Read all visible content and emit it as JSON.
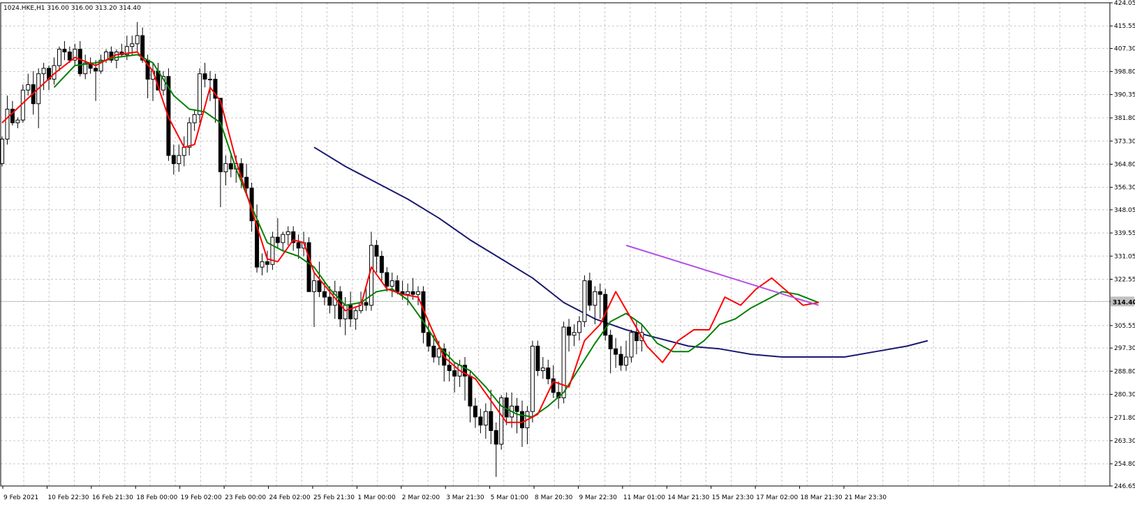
{
  "header": {
    "symbol": "1024.HKE,H1",
    "open": "316.00",
    "high": "316.00",
    "low": "313.20",
    "close": "314.40"
  },
  "colors": {
    "background": "#ffffff",
    "grid": "#c8c8c8",
    "axis": "#000000",
    "candle_up_body": "#ffffff",
    "candle_down_body": "#000000",
    "candle_outline": "#000000",
    "ma_red": "#ff0000",
    "ma_green": "#008000",
    "ma_navy": "#191970",
    "trend_purple": "#b450e6",
    "price_line": "#c0c0c0",
    "price_label_bg": "#c0c0c0"
  },
  "chart_data": {
    "type": "candlestick",
    "grid": true,
    "ylim": [
      246.65,
      424.05
    ],
    "y_ticks": [
      "424.05",
      "415.55",
      "407.30",
      "398.80",
      "390.35",
      "381.80",
      "373.30",
      "364.80",
      "356.30",
      "348.05",
      "339.55",
      "331.05",
      "322.55",
      "314.40",
      "305.55",
      "297.30",
      "288.80",
      "280.30",
      "271.80",
      "263.30",
      "254.80",
      "246.65"
    ],
    "x_ticks": [
      {
        "label": "9 Feb 2021",
        "i": 0
      },
      {
        "label": "10 Feb 22:30",
        "i": 14
      },
      {
        "label": "16 Feb 21:30",
        "i": 28
      },
      {
        "label": "18 Feb 00:00",
        "i": 42
      },
      {
        "label": "19 Feb 02:00",
        "i": 56
      },
      {
        "label": "23 Feb 00:00",
        "i": 70
      },
      {
        "label": "24 Feb 02:00",
        "i": 84
      },
      {
        "label": "25 Feb 21:30",
        "i": 98
      },
      {
        "label": "1 Mar 00:00",
        "i": 112
      },
      {
        "label": "2 Mar 02:00",
        "i": 126
      },
      {
        "label": "3 Mar 21:30",
        "i": 140
      },
      {
        "label": "5 Mar 01:00",
        "i": 154
      },
      {
        "label": "8 Mar 20:30",
        "i": 168
      },
      {
        "label": "9 Mar 22:30",
        "i": 182
      },
      {
        "label": "11 Mar 01:00",
        "i": 196
      },
      {
        "label": "14 Mar 21:30",
        "i": 210
      },
      {
        "label": "15 Mar 23:30",
        "i": 224
      },
      {
        "label": "17 Mar 02:00",
        "i": 238
      },
      {
        "label": "18 Mar 21:30",
        "i": 252
      },
      {
        "label": "21 Mar 23:30",
        "i": 266
      }
    ],
    "current_price": "314.40",
    "candles": [
      [
        365,
        375,
        364,
        374
      ],
      [
        374,
        390,
        372,
        385
      ],
      [
        385,
        388,
        379,
        380
      ],
      [
        380,
        382,
        378,
        381
      ],
      [
        381,
        394,
        380,
        392
      ],
      [
        392,
        398,
        390,
        394
      ],
      [
        394,
        399,
        383,
        387
      ],
      [
        387,
        400,
        378,
        398
      ],
      [
        398,
        402,
        392,
        400
      ],
      [
        400,
        401,
        392,
        396
      ],
      [
        396,
        404,
        394,
        401
      ],
      [
        401,
        408,
        399,
        407
      ],
      [
        407,
        410,
        403,
        406
      ],
      [
        406,
        408,
        402,
        403
      ],
      [
        403,
        409,
        401,
        407
      ],
      [
        407,
        410,
        397,
        398
      ],
      [
        398,
        405,
        396,
        402
      ],
      [
        402,
        404,
        398,
        400
      ],
      [
        400,
        403,
        388,
        399
      ],
      [
        399,
        405,
        398,
        403
      ],
      [
        403,
        407,
        402,
        406
      ],
      [
        406,
        408,
        402,
        403
      ],
      [
        403,
        407,
        400,
        406
      ],
      [
        406,
        409,
        404,
        405
      ],
      [
        405,
        412,
        403,
        408
      ],
      [
        408,
        412,
        405,
        409
      ],
      [
        409,
        417,
        406,
        412
      ],
      [
        412,
        415,
        402,
        403
      ],
      [
        403,
        405,
        389,
        396
      ],
      [
        396,
        402,
        388,
        399
      ],
      [
        399,
        402,
        393,
        392
      ],
      [
        392,
        399,
        390,
        397
      ],
      [
        397,
        400,
        366,
        368
      ],
      [
        368,
        372,
        361,
        365
      ],
      [
        365,
        372,
        362,
        368
      ],
      [
        368,
        375,
        364,
        371
      ],
      [
        371,
        382,
        368,
        380
      ],
      [
        380,
        385,
        377,
        383
      ],
      [
        383,
        400,
        380,
        398
      ],
      [
        398,
        402,
        393,
        396
      ],
      [
        396,
        399,
        388,
        396
      ],
      [
        396,
        398,
        380,
        389
      ],
      [
        389,
        366,
        349,
        362
      ],
      [
        362,
        368,
        357,
        365
      ],
      [
        365,
        369,
        360,
        363
      ],
      [
        363,
        368,
        358,
        365
      ],
      [
        365,
        367,
        356,
        360
      ],
      [
        360,
        365,
        353,
        356
      ],
      [
        356,
        358,
        340,
        344
      ],
      [
        344,
        350,
        325,
        327
      ],
      [
        327,
        332,
        324,
        329
      ],
      [
        329,
        333,
        325,
        328
      ],
      [
        328,
        340,
        326,
        338
      ],
      [
        338,
        345,
        334,
        336
      ],
      [
        336,
        340,
        333,
        339
      ],
      [
        339,
        342,
        335,
        340
      ],
      [
        340,
        342,
        333,
        336
      ],
      [
        336,
        339,
        330,
        334
      ],
      [
        334,
        340,
        331,
        336
      ],
      [
        336,
        338,
        325,
        318
      ],
      [
        318,
        325,
        305,
        322
      ],
      [
        322,
        329,
        316,
        318
      ],
      [
        318,
        322,
        313,
        316
      ],
      [
        316,
        320,
        310,
        313
      ],
      [
        313,
        322,
        308,
        318
      ],
      [
        318,
        320,
        305,
        308
      ],
      [
        308,
        316,
        302,
        313
      ],
      [
        313,
        318,
        305,
        308
      ],
      [
        308,
        312,
        304,
        311
      ],
      [
        311,
        318,
        310,
        314
      ],
      [
        314,
        320,
        311,
        313
      ],
      [
        313,
        340,
        311,
        335
      ],
      [
        335,
        337,
        325,
        331
      ],
      [
        331,
        333,
        322,
        325
      ],
      [
        325,
        327,
        318,
        320
      ],
      [
        320,
        325,
        316,
        322
      ],
      [
        322,
        324,
        317,
        318
      ],
      [
        318,
        322,
        315,
        317
      ],
      [
        317,
        321,
        313,
        318
      ],
      [
        318,
        323,
        315,
        317
      ],
      [
        317,
        320,
        313,
        318
      ],
      [
        318,
        320,
        299,
        303
      ],
      [
        303,
        307,
        296,
        298
      ],
      [
        298,
        302,
        292,
        294
      ],
      [
        294,
        300,
        291,
        297
      ],
      [
        297,
        299,
        285,
        291
      ],
      [
        291,
        296,
        285,
        289
      ],
      [
        289,
        292,
        281,
        287
      ],
      [
        287,
        293,
        283,
        291
      ],
      [
        291,
        294,
        278,
        287
      ],
      [
        287,
        289,
        270,
        276
      ],
      [
        276,
        279,
        268,
        272
      ],
      [
        272,
        275,
        266,
        269
      ],
      [
        269,
        277,
        264,
        274
      ],
      [
        274,
        282,
        262,
        267
      ],
      [
        267,
        270,
        250,
        262
      ],
      [
        262,
        280,
        260,
        279
      ],
      [
        279,
        281,
        269,
        272
      ],
      [
        272,
        281,
        268,
        276
      ],
      [
        276,
        279,
        266,
        274
      ],
      [
        274,
        278,
        261,
        268
      ],
      [
        268,
        276,
        262,
        274
      ],
      [
        274,
        300,
        270,
        298
      ],
      [
        298,
        300,
        287,
        289
      ],
      [
        289,
        294,
        286,
        290
      ],
      [
        290,
        293,
        284,
        286
      ],
      [
        286,
        291,
        279,
        281
      ],
      [
        281,
        285,
        275,
        279
      ],
      [
        279,
        307,
        277,
        305
      ],
      [
        305,
        308,
        296,
        302
      ],
      [
        302,
        306,
        298,
        303
      ],
      [
        303,
        309,
        300,
        307
      ],
      [
        307,
        324,
        305,
        322
      ],
      [
        322,
        325,
        311,
        313
      ],
      [
        313,
        320,
        306,
        318
      ],
      [
        318,
        321,
        308,
        317
      ],
      [
        317,
        319,
        300,
        302
      ],
      [
        302,
        304,
        288,
        297
      ],
      [
        297,
        301,
        290,
        295
      ],
      [
        295,
        298,
        289,
        291
      ],
      [
        291,
        300,
        289,
        294
      ],
      [
        294,
        304,
        292,
        303
      ],
      [
        303,
        307,
        295,
        300
      ],
      [
        300,
        306,
        296,
        303
      ]
    ],
    "ma_red": [
      [
        0,
        380
      ],
      [
        5,
        389
      ],
      [
        10,
        398
      ],
      [
        14,
        404
      ],
      [
        18,
        401
      ],
      [
        22,
        405
      ],
      [
        26,
        406
      ],
      [
        29,
        399
      ],
      [
        32,
        382
      ],
      [
        35,
        371
      ],
      [
        37,
        372
      ],
      [
        40,
        393
      ],
      [
        42,
        388
      ],
      [
        45,
        366
      ],
      [
        48,
        348
      ],
      [
        51,
        330
      ],
      [
        53,
        329
      ],
      [
        56,
        337
      ],
      [
        58,
        336
      ],
      [
        60,
        325
      ],
      [
        63,
        318
      ],
      [
        66,
        311
      ],
      [
        69,
        313
      ],
      [
        71,
        327
      ],
      [
        74,
        319
      ],
      [
        77,
        317
      ],
      [
        80,
        316
      ],
      [
        82,
        307
      ],
      [
        85,
        294
      ],
      [
        88,
        289
      ],
      [
        91,
        286
      ],
      [
        94,
        278
      ],
      [
        97,
        270
      ],
      [
        100,
        270
      ],
      [
        103,
        273
      ],
      [
        106,
        285
      ],
      [
        109,
        283
      ],
      [
        112,
        300
      ],
      [
        115,
        306
      ],
      [
        118,
        318
      ],
      [
        121,
        308
      ],
      [
        124,
        298
      ],
      [
        127,
        292
      ],
      [
        130,
        300
      ],
      [
        133,
        304
      ],
      [
        136,
        304
      ],
      [
        139,
        316
      ],
      [
        142,
        313
      ],
      [
        145,
        319
      ],
      [
        148,
        323
      ],
      [
        151,
        318
      ],
      [
        154,
        313
      ],
      [
        157,
        314
      ]
    ],
    "ma_green": [
      [
        10,
        393
      ],
      [
        14,
        401
      ],
      [
        18,
        402
      ],
      [
        22,
        404
      ],
      [
        26,
        405
      ],
      [
        29,
        402
      ],
      [
        33,
        390
      ],
      [
        36,
        385
      ],
      [
        39,
        384
      ],
      [
        42,
        380
      ],
      [
        45,
        363
      ],
      [
        48,
        349
      ],
      [
        51,
        336
      ],
      [
        54,
        333
      ],
      [
        57,
        331
      ],
      [
        60,
        327
      ],
      [
        63,
        319
      ],
      [
        66,
        313
      ],
      [
        69,
        314
      ],
      [
        72,
        318
      ],
      [
        75,
        319
      ],
      [
        78,
        315
      ],
      [
        81,
        307
      ],
      [
        84,
        298
      ],
      [
        87,
        292
      ],
      [
        90,
        289
      ],
      [
        93,
        283
      ],
      [
        96,
        276
      ],
      [
        99,
        273
      ],
      [
        102,
        272
      ],
      [
        105,
        276
      ],
      [
        108,
        281
      ],
      [
        111,
        290
      ],
      [
        114,
        299
      ],
      [
        117,
        307
      ],
      [
        120,
        310
      ],
      [
        123,
        306
      ],
      [
        126,
        299
      ],
      [
        129,
        296
      ],
      [
        132,
        296
      ],
      [
        135,
        300
      ],
      [
        138,
        306
      ],
      [
        141,
        308
      ],
      [
        144,
        312
      ],
      [
        147,
        315
      ],
      [
        150,
        318
      ],
      [
        153,
        317
      ],
      [
        157,
        314
      ]
    ],
    "ma_navy": [
      [
        60,
        371
      ],
      [
        66,
        364
      ],
      [
        72,
        358
      ],
      [
        78,
        352
      ],
      [
        84,
        345
      ],
      [
        90,
        337
      ],
      [
        96,
        330
      ],
      [
        102,
        323
      ],
      [
        108,
        314
      ],
      [
        114,
        308
      ],
      [
        120,
        304
      ],
      [
        126,
        301
      ],
      [
        132,
        298
      ],
      [
        138,
        297
      ],
      [
        144,
        295
      ],
      [
        150,
        294
      ],
      [
        156,
        294
      ],
      [
        162,
        294
      ],
      [
        168,
        296
      ],
      [
        174,
        298
      ],
      [
        178,
        300
      ]
    ],
    "trendline": [
      [
        120,
        335
      ],
      [
        157,
        313
      ]
    ]
  }
}
